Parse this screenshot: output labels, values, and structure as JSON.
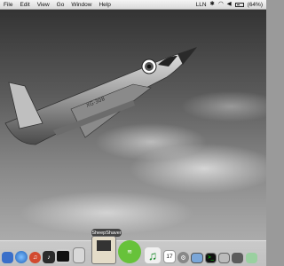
{
  "menubar": {
    "items": [
      "File",
      "Edit",
      "View",
      "Go",
      "Window",
      "Help"
    ],
    "right": {
      "input_menu": "LLN",
      "battery_label": "(64%)"
    }
  },
  "dock": {
    "tooltip": "SheepShaver",
    "icons": [
      "finder-icon",
      "safari-icon",
      "itunes-icon",
      "audio-icon",
      "monitor-icon",
      "gameboy-icon",
      "classic-mac-icon",
      "spotify-icon",
      "music-note-icon",
      "calendar-icon",
      "settings-icon",
      "photo-icon",
      "terminal-icon",
      "app-icon",
      "app-icon-2",
      "app-icon-3"
    ],
    "calendar_day": "17"
  }
}
